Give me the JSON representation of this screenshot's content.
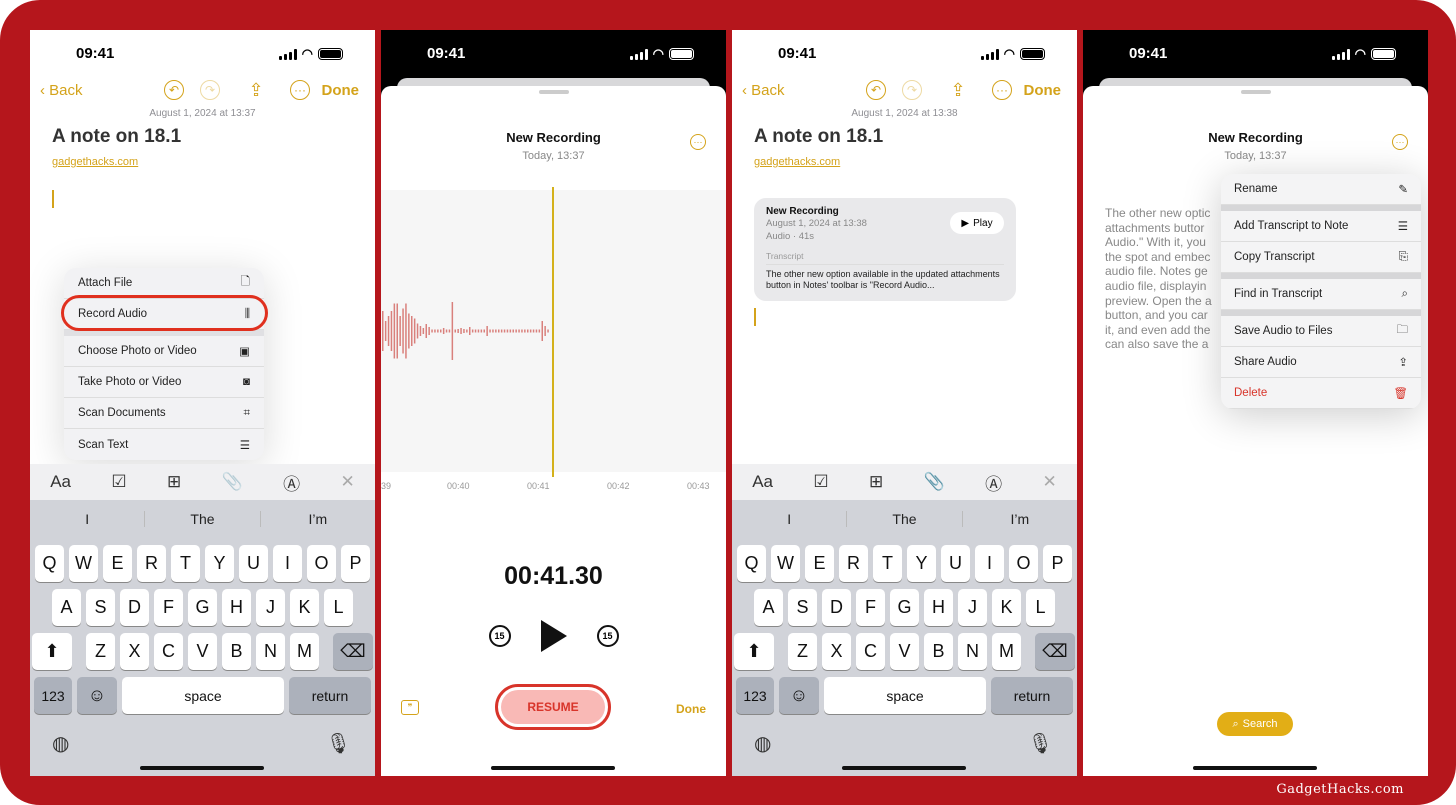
{
  "status": {
    "time": "09:41"
  },
  "screen1": {
    "nav": {
      "back": "Back",
      "done": "Done"
    },
    "date": "August 1, 2024 at 13:37",
    "title": "A note on 18.1",
    "link": "gadgethacks.com",
    "attach_menu": [
      {
        "label": "Attach File",
        "icon": "doc-icon",
        "glyph": "🗋"
      },
      {
        "label": "Record Audio",
        "icon": "waveform-icon",
        "glyph": "⫼",
        "highlighted": true
      },
      {
        "label": "Choose Photo or Video",
        "icon": "photo-icon",
        "glyph": "▣"
      },
      {
        "label": "Take Photo or Video",
        "icon": "camera-icon",
        "glyph": "◙"
      },
      {
        "label": "Scan Documents",
        "icon": "scan-doc-icon",
        "glyph": "⌗"
      },
      {
        "label": "Scan Text",
        "icon": "scan-text-icon",
        "glyph": "☰"
      }
    ]
  },
  "toolbar": {
    "format": "Aa",
    "checklist": "☑",
    "table": "⊞",
    "attach": "📎",
    "markup": "Ⓐ",
    "close": "✕"
  },
  "keyboard": {
    "suggestions": [
      "I",
      "The",
      "I’m"
    ],
    "row1": [
      "Q",
      "W",
      "E",
      "R",
      "T",
      "Y",
      "U",
      "I",
      "O",
      "P"
    ],
    "row2": [
      "A",
      "S",
      "D",
      "F",
      "G",
      "H",
      "J",
      "K",
      "L"
    ],
    "row3": [
      "Z",
      "X",
      "C",
      "V",
      "B",
      "N",
      "M"
    ],
    "shift": "⬆",
    "backspace": "⌫",
    "numbers": "123",
    "emoji": "☺",
    "space": "space",
    "return": "return",
    "globe": "🌐",
    "mic": "🎙"
  },
  "screen2": {
    "title": "New Recording",
    "subtitle": "Today, 13:37",
    "timeline": [
      "39",
      "00:40",
      "00:41",
      "00:42",
      "00:43"
    ],
    "timer": "00:41.30",
    "skip_back": "15",
    "skip_fwd": "15",
    "resume": "RESUME",
    "done": "Done"
  },
  "screen3": {
    "nav": {
      "back": "Back",
      "done": "Done"
    },
    "date": "August 1, 2024 at 13:38",
    "title": "A note on 18.1",
    "link": "gadgethacks.com",
    "card": {
      "title": "New Recording",
      "date": "August 1, 2024 at 13:38",
      "meta": "Audio · 41s",
      "play": "Play",
      "transcript_label": "Transcript",
      "transcript": "The other new option available in the updated attachments button in Notes' toolbar is \"Record Audio..."
    }
  },
  "screen4": {
    "title": "New Recording",
    "subtitle": "Today, 13:37",
    "transcript_lines": [
      "The other new optic",
      "attachments buttor",
      "Audio.\" With it, you",
      "the spot and embec",
      "audio file. Notes ge",
      "audio file, displayin",
      "preview. Open the a",
      "button, and you car",
      "it, and even add the",
      "can also save the a"
    ],
    "menu": [
      {
        "label": "Rename",
        "glyph": "✎",
        "sep_after": true
      },
      {
        "label": "Add Transcript to Note",
        "glyph": "☰"
      },
      {
        "label": "Copy Transcript",
        "glyph": "⎘",
        "sep_after": true
      },
      {
        "label": "Find in Transcript",
        "glyph": "⌕",
        "sep_after": true
      },
      {
        "label": "Save Audio to Files",
        "glyph": "🗀"
      },
      {
        "label": "Share Audio",
        "glyph": "⇪"
      },
      {
        "label": "Delete",
        "glyph": "🗑",
        "destructive": true
      }
    ],
    "search": "Search"
  },
  "watermark": "GadgetHacks.com",
  "colors": {
    "accent": "#d4a31b",
    "frame": "#b5161c",
    "destructive": "#d8342a"
  }
}
